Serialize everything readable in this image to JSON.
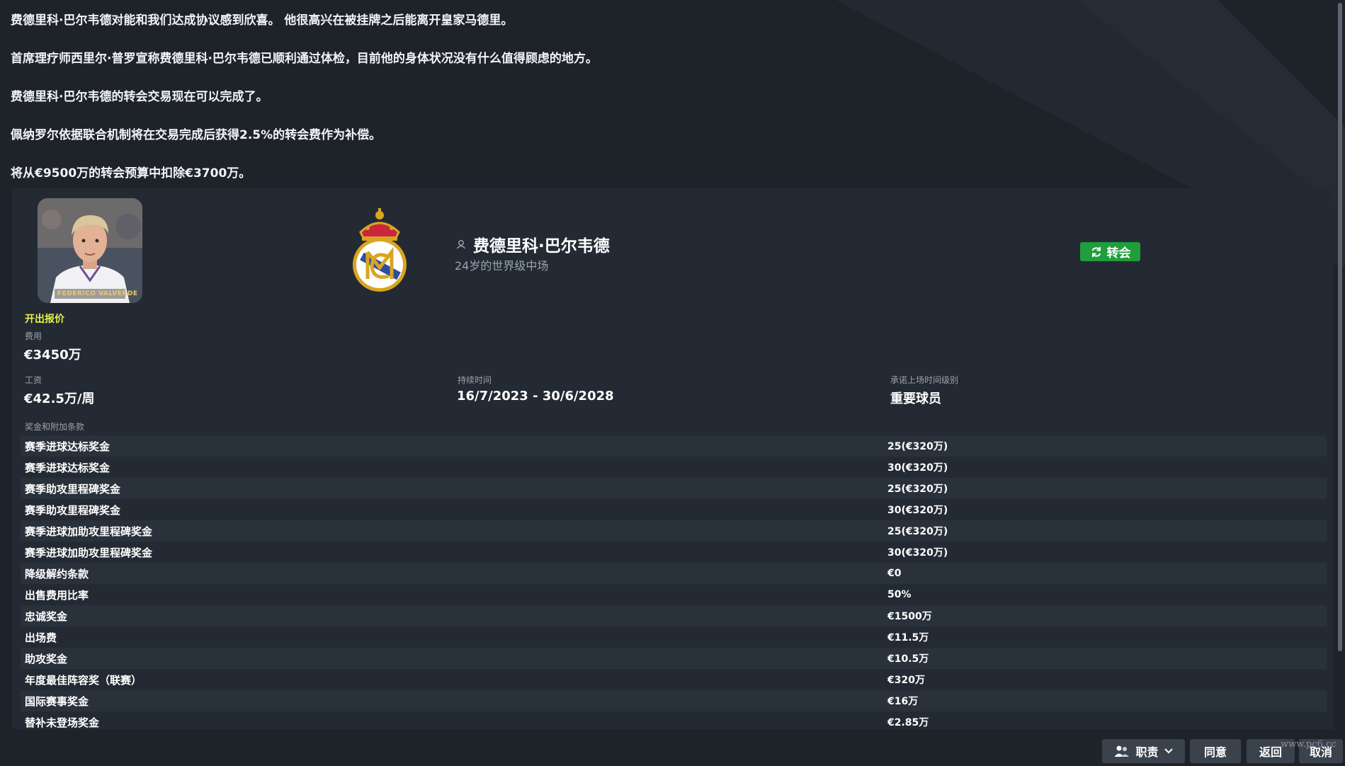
{
  "messages": [
    "费德里科·巴尔韦德对能和我们达成协议感到欣喜。 他很高兴在被挂牌之后能离开皇家马德里。",
    "首席理疗师西里尔·普罗宣称费德里科·巴尔韦德已顺利通过体检，目前他的身体状况没有什么值得顾虑的地方。",
    "费德里科·巴尔韦德的转会交易现在可以完成了。",
    "佩纳罗尔依据联合机制将在交易完成后获得2.5%的转会费作为补偿。",
    "将从€9500万的转会预算中扣除€3700万。"
  ],
  "player": {
    "name": "费德里科·巴尔韦德",
    "description": "24岁的世界级中场",
    "portrait_caption": "FEDERICO VALVERDE"
  },
  "transfer_badge": "转会",
  "offer": {
    "heading": "开出报价",
    "fee_label": "费用",
    "fee_value": "€3450万",
    "wage_label": "工资",
    "wage_value": "€42.5万/周",
    "duration_label": "持续时间",
    "duration_value": "16/7/2023 - 30/6/2028",
    "playing_time_label": "承诺上场时间级别",
    "playing_time_value": "重要球员",
    "bonus_label": "奖金和附加条款"
  },
  "bonuses": [
    {
      "name": "赛季进球达标奖金",
      "value": "25(€320万)"
    },
    {
      "name": "赛季进球达标奖金",
      "value": "30(€320万)"
    },
    {
      "name": "赛季助攻里程碑奖金",
      "value": "25(€320万)"
    },
    {
      "name": "赛季助攻里程碑奖金",
      "value": "30(€320万)"
    },
    {
      "name": "赛季进球加助攻里程碑奖金",
      "value": "25(€320万)"
    },
    {
      "name": "赛季进球加助攻里程碑奖金",
      "value": "30(€320万)"
    },
    {
      "name": "降级解约条款",
      "value": "€0"
    },
    {
      "name": "出售费用比率",
      "value": "50%"
    },
    {
      "name": "忠诚奖金",
      "value": "€1500万"
    },
    {
      "name": "出场费",
      "value": "€11.5万"
    },
    {
      "name": "助攻奖金",
      "value": "€10.5万"
    },
    {
      "name": "年度最佳阵容奖（联赛）",
      "value": "€320万"
    },
    {
      "name": "国际赛事奖金",
      "value": "€16万"
    },
    {
      "name": "替补未登场奖金",
      "value": "€2.85万"
    }
  ],
  "bottom_buttons": {
    "duty": "职责",
    "agree": "同意",
    "back": "返回",
    "cancel": "取消"
  },
  "watermark": "www.pc6.cc",
  "colors": {
    "background": "#1e2329",
    "card": "#232a33",
    "accent_green": "#1f9e3b",
    "offer_yellow": "#e4f24a",
    "button": "#3a424c"
  }
}
